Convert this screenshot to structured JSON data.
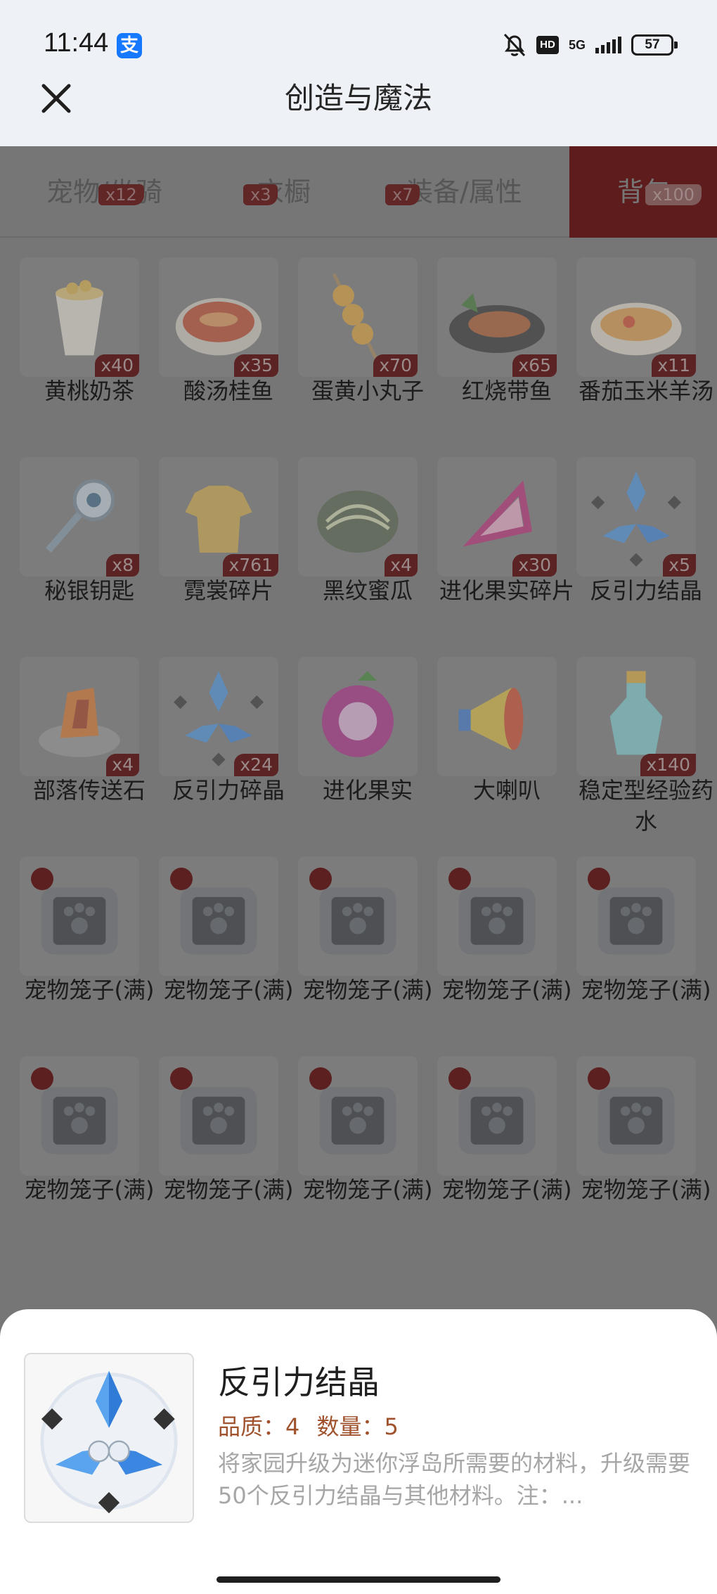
{
  "status": {
    "time": "11:44",
    "alipay_glyph": "支",
    "hd": "HD",
    "signal": "5G",
    "battery": "57"
  },
  "header": {
    "title": "创造与魔法",
    "close_icon": "close-icon"
  },
  "tabs": [
    {
      "label": "宠物/坐骑",
      "count": "x12"
    },
    {
      "label": "衣橱",
      "count": "x3"
    },
    {
      "label": "装备/属性",
      "count": "x7"
    },
    {
      "label": "背包",
      "count": "x100",
      "active": true
    }
  ],
  "items": [
    {
      "name": "黄桃奶茶",
      "count": "x40",
      "icon": "milk-tea-icon"
    },
    {
      "name": "酸汤桂鱼",
      "count": "x35",
      "icon": "fish-soup-icon"
    },
    {
      "name": "蛋黄小丸子",
      "count": "x70",
      "icon": "skewer-icon"
    },
    {
      "name": "红烧带鱼",
      "count": "x65",
      "icon": "braised-fish-icon"
    },
    {
      "name": "番茄玉米羊汤",
      "count": "x11",
      "icon": "mutton-soup-icon"
    },
    {
      "name": "秘银钥匙",
      "count": "x8",
      "icon": "key-icon"
    },
    {
      "name": "霓裳碎片",
      "count": "x761",
      "icon": "shirt-icon"
    },
    {
      "name": "黑纹蜜瓜",
      "count": "x4",
      "icon": "melon-icon"
    },
    {
      "name": "进化果实碎片",
      "count": "x30",
      "icon": "fruit-shard-icon"
    },
    {
      "name": "反引力结晶",
      "count": "x5",
      "icon": "crystal-icon"
    },
    {
      "name": "部落传送石",
      "count": "x4",
      "icon": "teleport-stone-icon"
    },
    {
      "name": "反引力碎晶",
      "count": "x24",
      "icon": "crystal-icon"
    },
    {
      "name": "进化果实",
      "count": "",
      "icon": "berry-icon"
    },
    {
      "name": "大喇叭",
      "count": "",
      "icon": "megaphone-icon"
    },
    {
      "name": "稳定型经验药水",
      "count": "x140",
      "icon": "potion-icon"
    },
    {
      "name": "宠物笼子(满)",
      "count": "",
      "icon": "pet-cage-icon"
    },
    {
      "name": "宠物笼子(满)",
      "count": "",
      "icon": "pet-cage-icon"
    },
    {
      "name": "宠物笼子(满)",
      "count": "",
      "icon": "pet-cage-icon"
    },
    {
      "name": "宠物笼子(满)",
      "count": "",
      "icon": "pet-cage-icon"
    },
    {
      "name": "宠物笼子(满)",
      "count": "",
      "icon": "pet-cage-icon"
    },
    {
      "name": "宠物笼子(满)",
      "count": "",
      "icon": "pet-cage-icon"
    },
    {
      "name": "宠物笼子(满)",
      "count": "",
      "icon": "pet-cage-icon"
    },
    {
      "name": "宠物笼子(满)",
      "count": "",
      "icon": "pet-cage-icon"
    },
    {
      "name": "宠物笼子(满)",
      "count": "",
      "icon": "pet-cage-icon"
    },
    {
      "name": "宠物笼子(满)",
      "count": "",
      "icon": "pet-cage-icon"
    }
  ],
  "detail": {
    "title": "反引力结晶",
    "quality_label": "品质：4",
    "quantity_label": "数量：5",
    "description": "将家园升级为迷你浮岛所需要的材料，升级需要50个反引力结晶与其他材料。注：...",
    "icon": "crystal-icon"
  },
  "colors": {
    "accent": "#a0522d",
    "active_tab": "#5e1c1c",
    "overlay": "#767676"
  }
}
